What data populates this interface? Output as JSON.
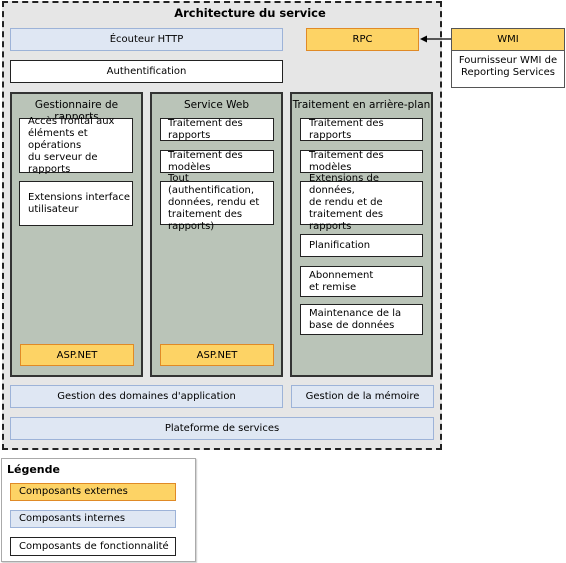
{
  "title": "Architecture du service",
  "http_listener": "Écouteur HTTP",
  "authentication": "Authentification",
  "rpc": "RPC",
  "wmi": {
    "header": "WMI",
    "body_line1": "Fournisseur WMI de",
    "body_line2": "Reporting Services"
  },
  "columns": [
    {
      "title": "Gestionnaire de rapports",
      "items": [
        [
          "Accès frontal aux",
          "éléments et opérations",
          "du serveur de rapports"
        ],
        [
          "Extensions interface",
          "utilisateur"
        ]
      ],
      "footer": "ASP.NET"
    },
    {
      "title": "Service Web",
      "items": [
        [
          "Traitement des rapports"
        ],
        [
          "Traitement des modèles"
        ],
        [
          "Tout (authentification,",
          "données, rendu et",
          "traitement des rapports)"
        ]
      ],
      "footer": "ASP.NET"
    },
    {
      "title": "Traitement en arrière-plan",
      "items": [
        [
          "Traitement des rapports"
        ],
        [
          "Traitement des modèles"
        ],
        [
          "Extensions de données,",
          "de rendu et de",
          "traitement des rapports"
        ],
        [
          "Planification"
        ],
        [
          "Abonnement",
          "et remise"
        ],
        [
          "Maintenance de la",
          "base de données"
        ]
      ]
    }
  ],
  "app_domain_management": "Gestion des domaines d'application",
  "memory_management": "Gestion de la mémoire",
  "service_platform": "Plateforme de services",
  "legend": {
    "title": "Légende",
    "external": "Composants externes",
    "internal": "Composants internes",
    "feature": "Composants de fonctionnalité"
  },
  "colors": {
    "external": "#fdd365",
    "internal": "#dfe7f3",
    "feature": "#ffffff",
    "column": "#bac4b8",
    "frame": "#e6e6e6"
  }
}
